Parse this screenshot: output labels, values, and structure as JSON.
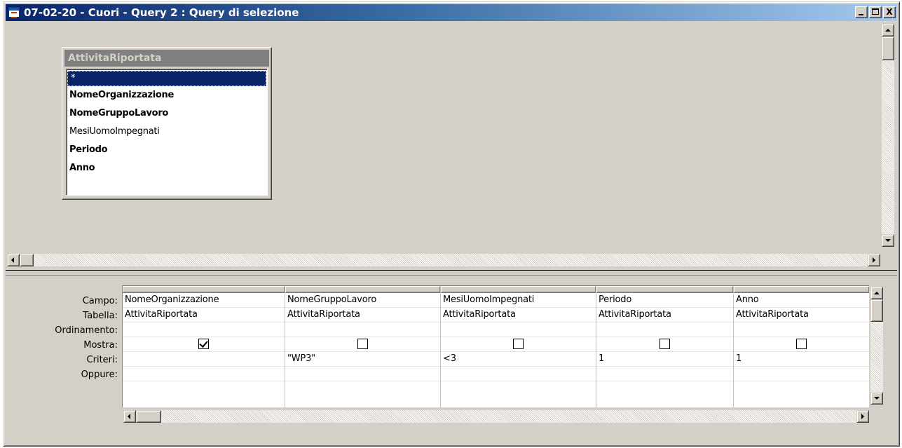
{
  "window": {
    "title": "07-02-20 - Cuori - Query 2 : Query di selezione",
    "controls": {
      "minimize": "_",
      "maximize": "□",
      "close": "X"
    }
  },
  "table": {
    "name": "AttivitaRiportata",
    "fields": [
      {
        "label": "*",
        "bold": false,
        "selected": true
      },
      {
        "label": "NomeOrganizzazione",
        "bold": true,
        "selected": false
      },
      {
        "label": "NomeGruppoLavoro",
        "bold": true,
        "selected": false
      },
      {
        "label": "MesiUomoImpegnati",
        "bold": false,
        "selected": false
      },
      {
        "label": "Periodo",
        "bold": true,
        "selected": false
      },
      {
        "label": "Anno",
        "bold": true,
        "selected": false
      }
    ]
  },
  "grid": {
    "row_labels": [
      "Campo:",
      "Tabella:",
      "Ordinamento:",
      "Mostra:",
      "Criteri:",
      "Oppure:"
    ],
    "columns": [
      {
        "campo": "NomeOrganizzazione",
        "tabella": "AttivitaRiportata",
        "ordinamento": "",
        "mostra": true,
        "criteri": "",
        "oppure": ""
      },
      {
        "campo": "NomeGruppoLavoro",
        "tabella": "AttivitaRiportata",
        "ordinamento": "",
        "mostra": false,
        "criteri": "\"WP3\"",
        "oppure": ""
      },
      {
        "campo": "MesiUomoImpegnati",
        "tabella": "AttivitaRiportata",
        "ordinamento": "",
        "mostra": false,
        "criteri": "<3",
        "oppure": ""
      },
      {
        "campo": "Periodo",
        "tabella": "AttivitaRiportata",
        "ordinamento": "",
        "mostra": false,
        "criteri": "1",
        "oppure": ""
      },
      {
        "campo": "Anno",
        "tabella": "AttivitaRiportata",
        "ordinamento": "",
        "mostra": false,
        "criteri": "1",
        "oppure": ""
      }
    ]
  }
}
